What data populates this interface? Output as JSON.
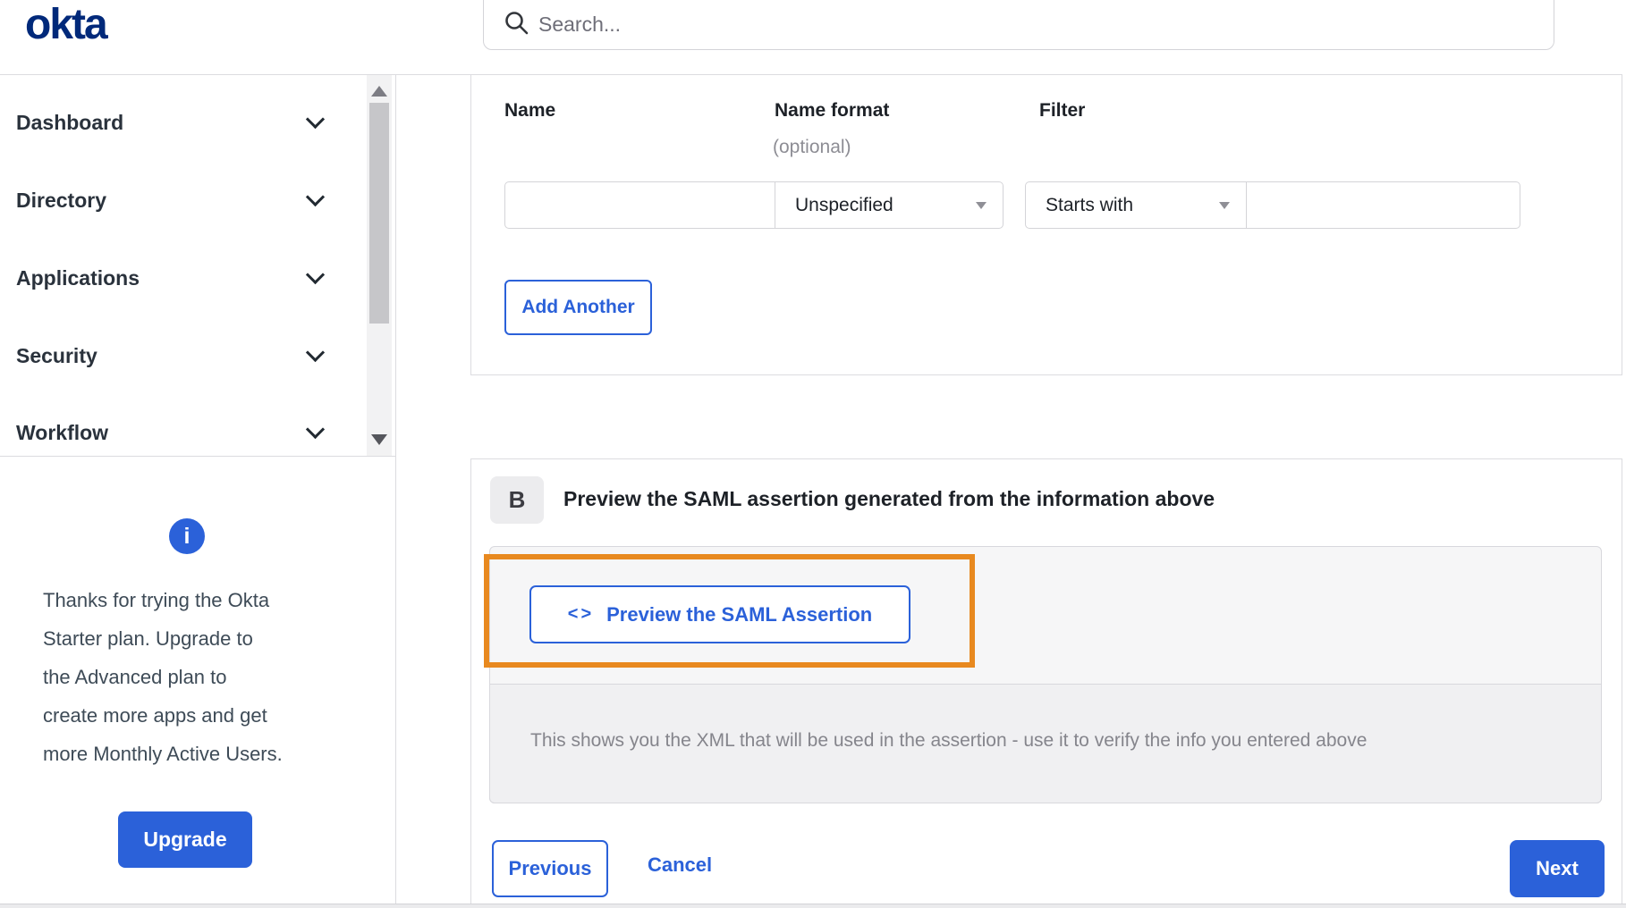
{
  "header": {
    "logo": "okta",
    "search": {
      "placeholder": "Search..."
    }
  },
  "sidebar": {
    "items": [
      {
        "label": "Dashboard"
      },
      {
        "label": "Directory"
      },
      {
        "label": "Applications"
      },
      {
        "label": "Security"
      },
      {
        "label": "Workflow"
      }
    ],
    "upgrade": {
      "message_lines": [
        "Thanks for trying the Okta",
        "Starter plan. Upgrade to",
        "the Advanced plan to",
        "create more apps and get",
        "more Monthly Active Users."
      ],
      "button_label": "Upgrade"
    }
  },
  "icons": {
    "info": "i"
  },
  "form": {
    "columns": {
      "name_label": "Name",
      "name_format_label": "Name format",
      "name_format_optional": "(optional)",
      "filter_label": "Filter"
    },
    "row": {
      "name_value": "",
      "name_format_selected": "Unspecified",
      "filter_type_selected": "Starts with",
      "filter_value": ""
    },
    "add_another_label": "Add Another"
  },
  "preview_section": {
    "step_badge": "B",
    "heading": "Preview the SAML assertion generated from the information above",
    "code_icon": "<>",
    "preview_button_label": "Preview the SAML Assertion",
    "description": "This shows you the XML that will be used in the assertion - use it to verify the info you entered above"
  },
  "footer": {
    "previous_label": "Previous",
    "cancel_label": "Cancel",
    "next_label": "Next"
  },
  "colors": {
    "primary_blue": "#2b61d9",
    "brand_navy": "#00297a",
    "highlight_orange": "#e8891f"
  }
}
